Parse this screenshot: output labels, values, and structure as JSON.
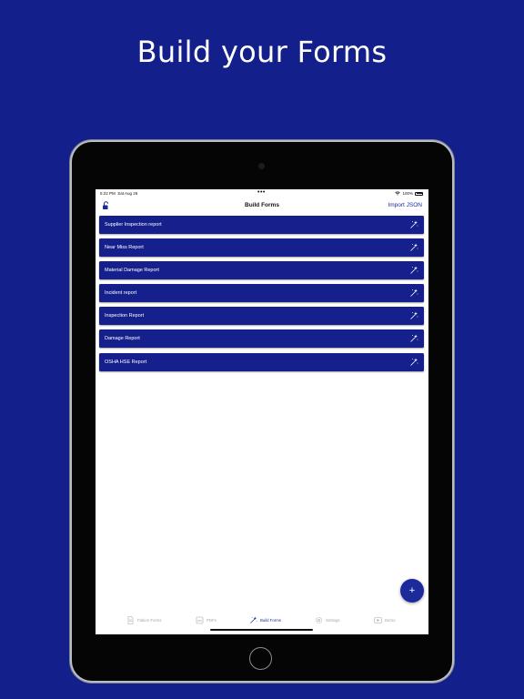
{
  "headline": "Build your Forms",
  "status_bar": {
    "time": "5:22 PM",
    "date": "Sat Aug 26",
    "dots": "•••",
    "battery": "100%"
  },
  "nav_bar": {
    "title": "Build Forms",
    "import_label": "Import JSON"
  },
  "forms": [
    {
      "label": "Supplier Inspection report"
    },
    {
      "label": "Near Miss Report"
    },
    {
      "label": "Material Damage Report"
    },
    {
      "label": "Incident report"
    },
    {
      "label": "Inspection Report"
    },
    {
      "label": "Damage Report"
    },
    {
      "label": "OSHA HSE Report"
    }
  ],
  "fab": {
    "label": "+"
  },
  "tabs": [
    {
      "label": "Fabion Forms",
      "icon": "document-icon"
    },
    {
      "label": "PDFs",
      "icon": "pdf-icon"
    },
    {
      "label": "Build Forms",
      "icon": "magic-wand-icon",
      "active": true
    },
    {
      "label": "Settings",
      "icon": "gear-icon"
    },
    {
      "label": "Demo",
      "icon": "play-icon"
    }
  ],
  "colors": {
    "background": "#131f8a",
    "row": "#16208c",
    "accent": "#1a2c9a"
  }
}
